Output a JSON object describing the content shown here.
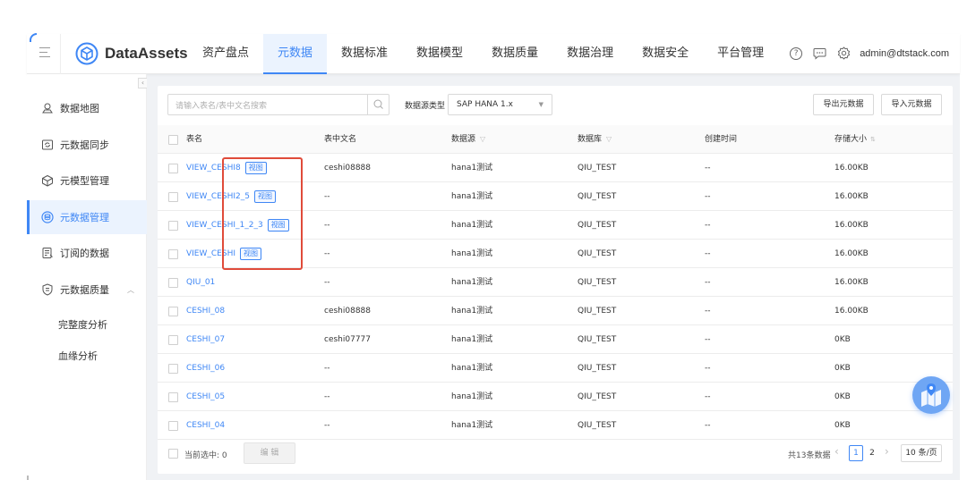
{
  "brand": {
    "name": "DataAssets"
  },
  "nav": {
    "items": [
      "资产盘点",
      "元数据",
      "数据标准",
      "数据模型",
      "数据质量",
      "数据治理",
      "数据安全",
      "平台管理"
    ],
    "active_index": 1
  },
  "topbar": {
    "user_email": "admin@dtstack.com",
    "icons": [
      "help-icon",
      "message-icon",
      "settings-icon"
    ]
  },
  "sidebar": {
    "items": [
      {
        "label": "数据地图",
        "icon": "map-icon"
      },
      {
        "label": "元数据同步",
        "icon": "sync-icon"
      },
      {
        "label": "元模型管理",
        "icon": "cube-icon"
      },
      {
        "label": "元数据管理",
        "icon": "database-icon",
        "active": true
      },
      {
        "label": "订阅的数据",
        "icon": "subscribe-icon"
      },
      {
        "label": "元数据质量",
        "icon": "shield-icon",
        "expanded": true
      }
    ],
    "subitems": [
      "完整度分析",
      "血缘分析"
    ]
  },
  "toolbar": {
    "search_placeholder": "请输入表名/表中文名搜索",
    "source_type_label": "数据源类型",
    "source_type_value": "SAP HANA 1.x",
    "export_label": "导出元数据",
    "import_label": "导入元数据"
  },
  "table": {
    "columns": [
      "表名",
      "表中文名",
      "数据源",
      "数据库",
      "创建时间",
      "存储大小"
    ],
    "view_tag": "视图",
    "rows": [
      {
        "name": "VIEW_CESHI8",
        "cn_name": "ceshi08888",
        "source": "hana1测试",
        "db": "QIU_TEST",
        "created": "--",
        "size": "16.00KB",
        "is_view": true
      },
      {
        "name": "VIEW_CESHI2_5",
        "cn_name": "--",
        "source": "hana1测试",
        "db": "QIU_TEST",
        "created": "--",
        "size": "16.00KB",
        "is_view": true
      },
      {
        "name": "VIEW_CESHI_1_2_3",
        "cn_name": "--",
        "source": "hana1测试",
        "db": "QIU_TEST",
        "created": "--",
        "size": "16.00KB",
        "is_view": true
      },
      {
        "name": "VIEW_CESHI",
        "cn_name": "--",
        "source": "hana1测试",
        "db": "QIU_TEST",
        "created": "--",
        "size": "16.00KB",
        "is_view": true
      },
      {
        "name": "QIU_01",
        "cn_name": "--",
        "source": "hana1测试",
        "db": "QIU_TEST",
        "created": "--",
        "size": "16.00KB",
        "is_view": false
      },
      {
        "name": "CESHI_08",
        "cn_name": "ceshi08888",
        "source": "hana1测试",
        "db": "QIU_TEST",
        "created": "--",
        "size": "16.00KB",
        "is_view": false
      },
      {
        "name": "CESHI_07",
        "cn_name": "ceshi07777",
        "source": "hana1测试",
        "db": "QIU_TEST",
        "created": "--",
        "size": "0KB",
        "is_view": false
      },
      {
        "name": "CESHI_06",
        "cn_name": "--",
        "source": "hana1测试",
        "db": "QIU_TEST",
        "created": "--",
        "size": "0KB",
        "is_view": false
      },
      {
        "name": "CESHI_05",
        "cn_name": "--",
        "source": "hana1测试",
        "db": "QIU_TEST",
        "created": "--",
        "size": "0KB",
        "is_view": false
      },
      {
        "name": "CESHI_04",
        "cn_name": "--",
        "source": "hana1测试",
        "db": "QIU_TEST",
        "created": "--",
        "size": "0KB",
        "is_view": false
      }
    ]
  },
  "footer": {
    "selected_label": "当前选中: 0",
    "edit_label": "编 辑",
    "total_label": "共13条数据",
    "pages": [
      "1",
      "2"
    ],
    "current_page": "1",
    "page_size": "10 条/页"
  },
  "colors": {
    "accent": "#3f87f5",
    "highlight": "#e04b3a"
  }
}
